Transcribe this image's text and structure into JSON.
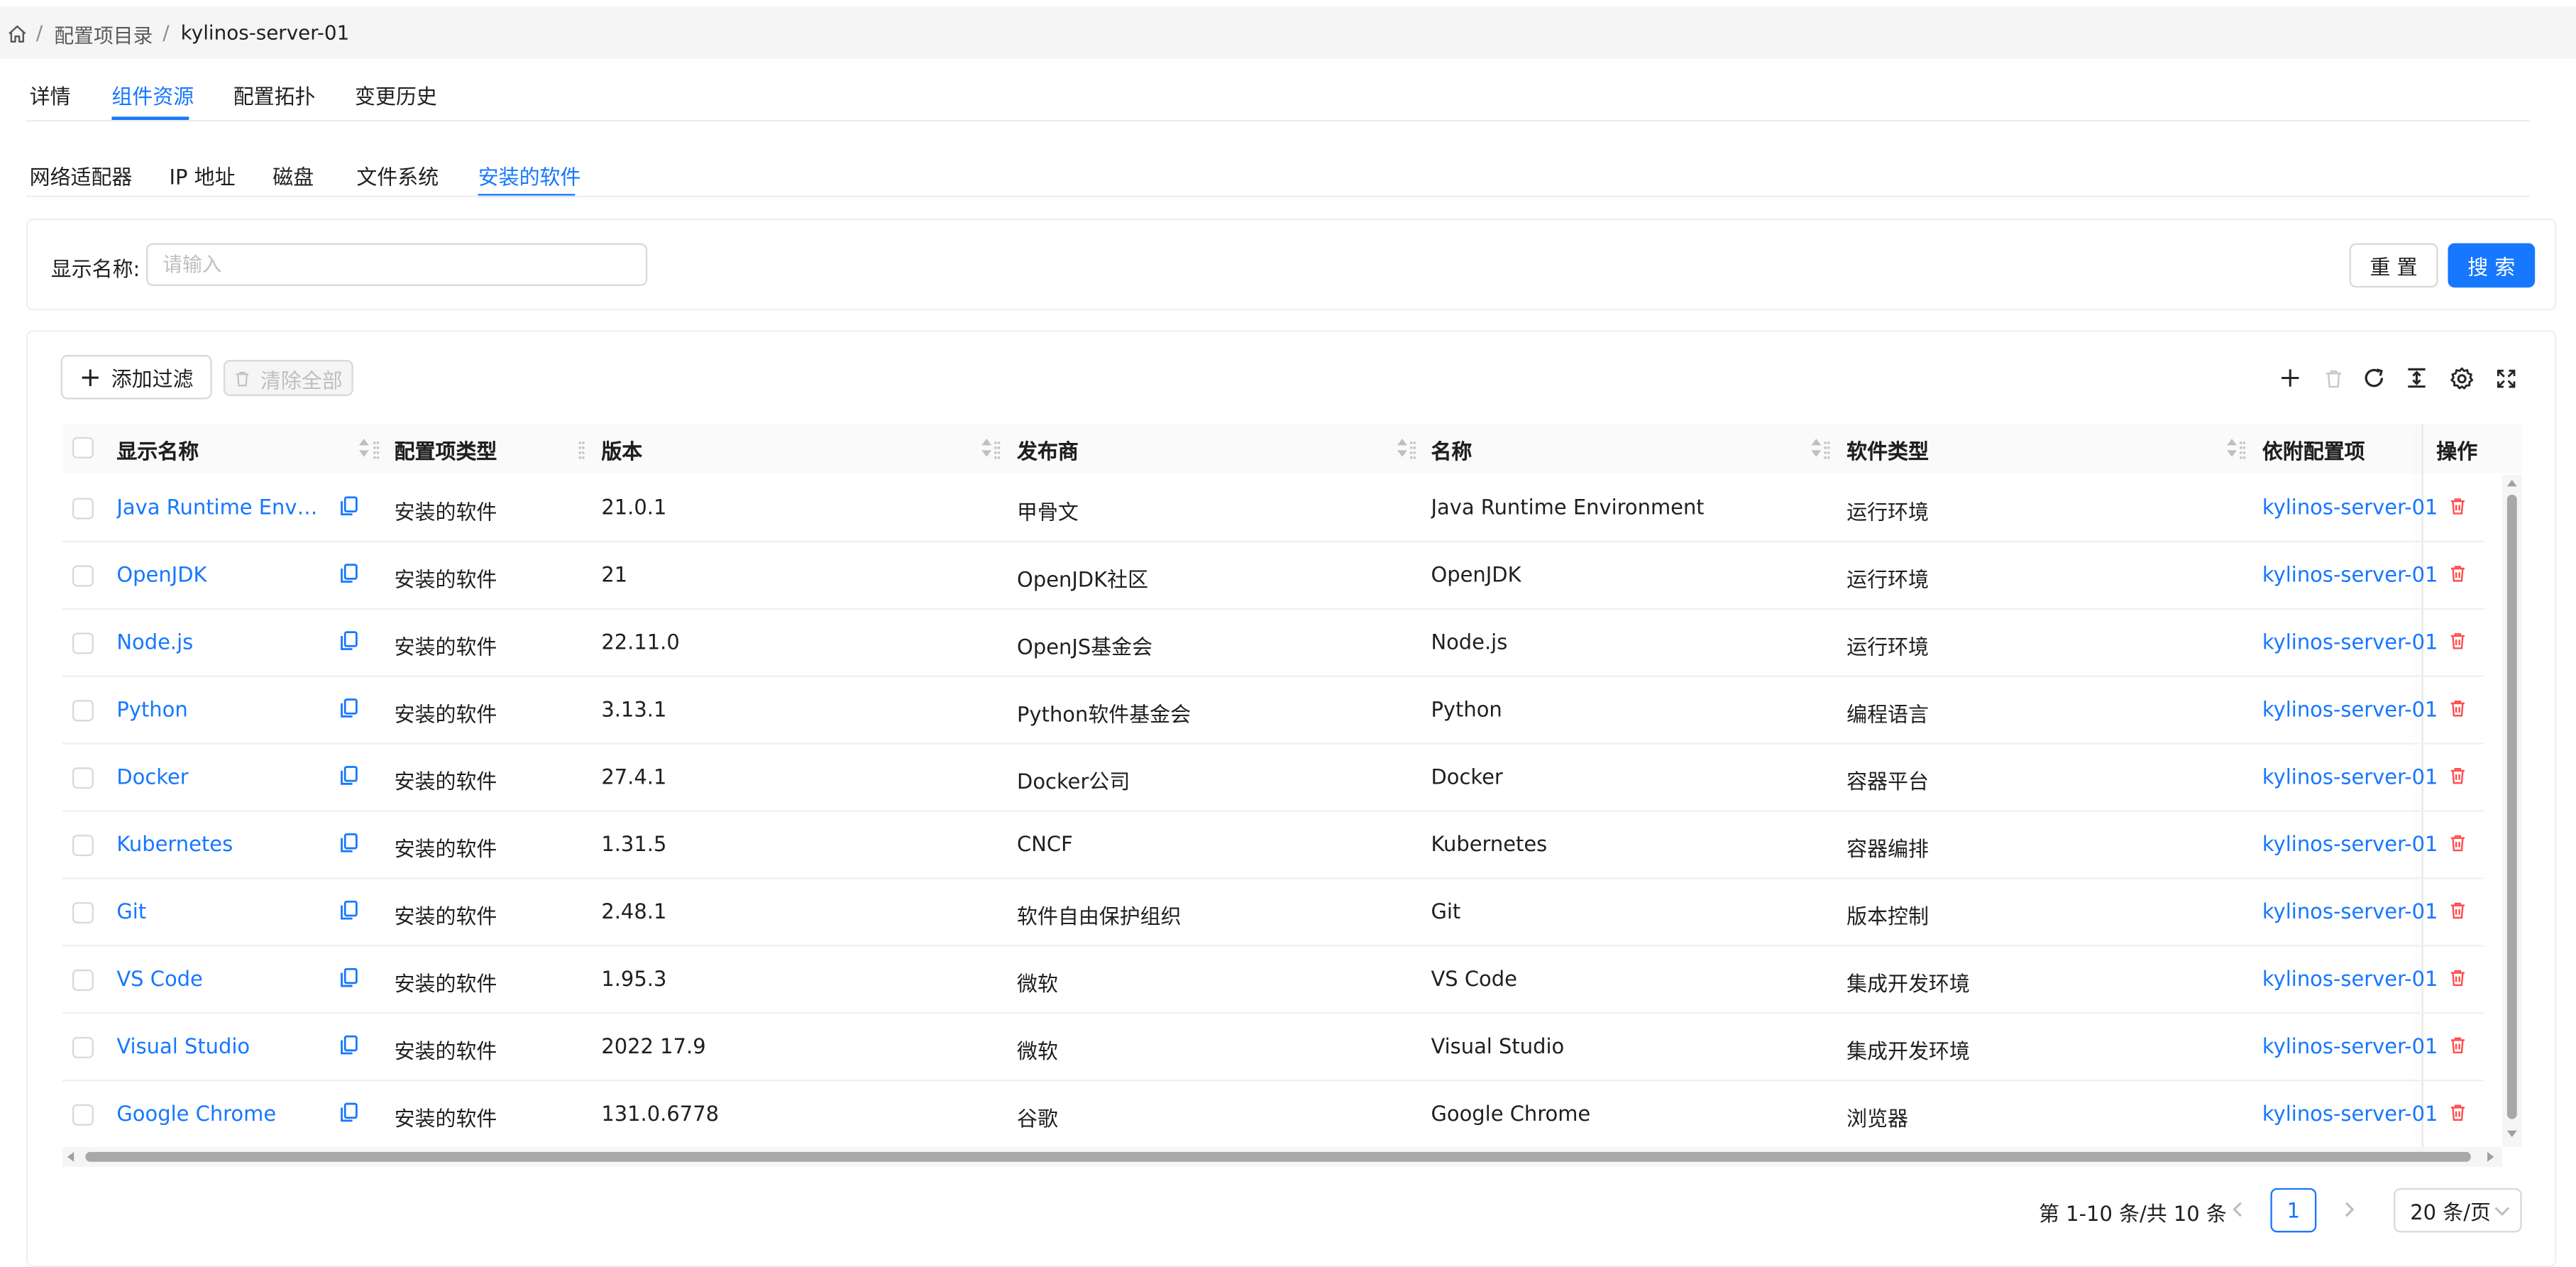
{
  "breadcrumb": {
    "level1": "配置项目录",
    "current": "kylinos-server-01",
    "separator": "/"
  },
  "main_tabs": [
    "详情",
    "组件资源",
    "配置拓扑",
    "变更历史"
  ],
  "sub_tabs": [
    "网络适配器",
    "IP 地址",
    "磁盘",
    "文件系统",
    "安装的软件"
  ],
  "search": {
    "label": "显示名称:",
    "placeholder": "请输入",
    "value": "",
    "reset": "重 置",
    "submit": "搜 索"
  },
  "toolbar": {
    "add_filter": "添加过滤",
    "clear_all": "清除全部"
  },
  "columns": [
    "显示名称",
    "配置项类型",
    "版本",
    "发布商",
    "名称",
    "软件类型",
    "依附配置项",
    "操作"
  ],
  "rows": [
    {
      "display": "Java Runtime Environ...",
      "type": "安装的软件",
      "version": "21.0.1",
      "publisher": "甲骨文",
      "name": "Java Runtime Environment",
      "category": "运行环境",
      "ci": "kylinos-server-01"
    },
    {
      "display": "OpenJDK",
      "type": "安装的软件",
      "version": "21",
      "publisher": "OpenJDK社区",
      "name": "OpenJDK",
      "category": "运行环境",
      "ci": "kylinos-server-01"
    },
    {
      "display": "Node.js",
      "type": "安装的软件",
      "version": "22.11.0",
      "publisher": "OpenJS基金会",
      "name": "Node.js",
      "category": "运行环境",
      "ci": "kylinos-server-01"
    },
    {
      "display": "Python",
      "type": "安装的软件",
      "version": "3.13.1",
      "publisher": "Python软件基金会",
      "name": "Python",
      "category": "编程语言",
      "ci": "kylinos-server-01"
    },
    {
      "display": "Docker",
      "type": "安装的软件",
      "version": "27.4.1",
      "publisher": "Docker公司",
      "name": "Docker",
      "category": "容器平台",
      "ci": "kylinos-server-01"
    },
    {
      "display": "Kubernetes",
      "type": "安装的软件",
      "version": "1.31.5",
      "publisher": "CNCF",
      "name": "Kubernetes",
      "category": "容器编排",
      "ci": "kylinos-server-01"
    },
    {
      "display": "Git",
      "type": "安装的软件",
      "version": "2.48.1",
      "publisher": "软件自由保护组织",
      "name": "Git",
      "category": "版本控制",
      "ci": "kylinos-server-01"
    },
    {
      "display": "VS Code",
      "type": "安装的软件",
      "version": "1.95.3",
      "publisher": "微软",
      "name": "VS Code",
      "category": "集成开发环境",
      "ci": "kylinos-server-01"
    },
    {
      "display": "Visual Studio",
      "type": "安装的软件",
      "version": "2022 17.9",
      "publisher": "微软",
      "name": "Visual Studio",
      "category": "集成开发环境",
      "ci": "kylinos-server-01"
    },
    {
      "display": "Google Chrome",
      "type": "安装的软件",
      "version": "131.0.6778",
      "publisher": "谷歌",
      "name": "Google Chrome",
      "category": "浏览器",
      "ci": "kylinos-server-01"
    }
  ],
  "pagination": {
    "summary": "第 1-10 条/共 10 条",
    "current_page": "1",
    "page_size": "20 条/页"
  },
  "colors": {
    "accent": "#1677ff",
    "danger": "#ff4d4f"
  }
}
